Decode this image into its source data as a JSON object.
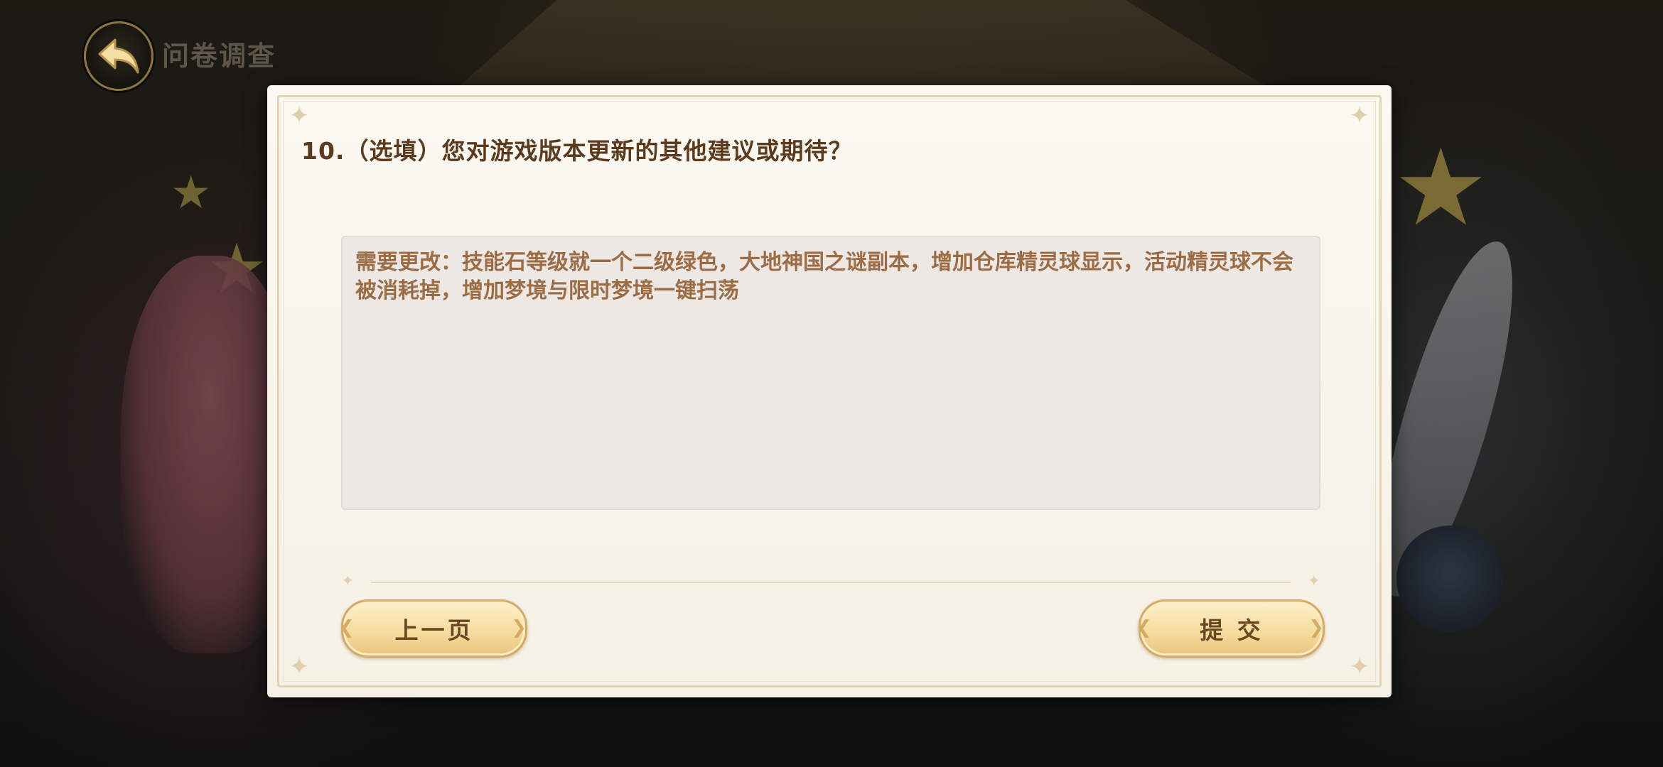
{
  "header": {
    "title": "问卷调查",
    "back_icon": "back-arrow-icon"
  },
  "survey": {
    "question": "10.（选填）您对游戏版本更新的其他建议或期待？",
    "answer": "需要更改：技能石等级就一个二级绿色，大地神国之谜副本，增加仓库精灵球显示，活动精灵球不会被消耗掉，增加梦境与限时梦境一键扫荡"
  },
  "buttons": {
    "prev_label": "上一页",
    "submit_label": "提 交"
  },
  "colors": {
    "panel_bg": "#f7f4ec",
    "question_text": "#5b3a1d",
    "answer_text": "#9c6c45",
    "button_gold": "#f5dda0"
  }
}
